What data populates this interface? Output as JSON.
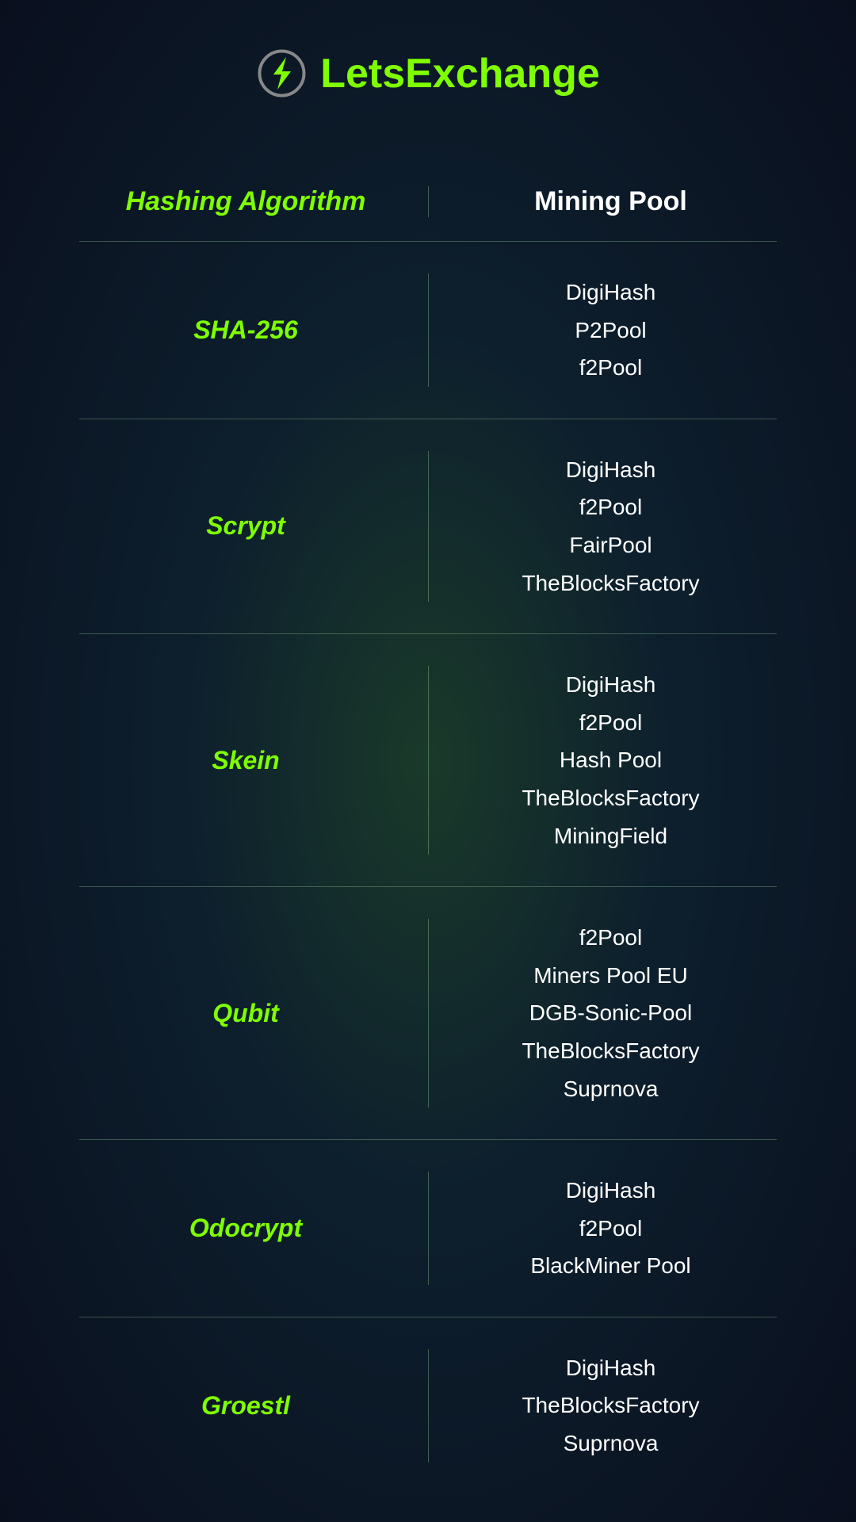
{
  "header": {
    "logo_text_plain": "Lets",
    "logo_text_accent": "Exchange",
    "logo_icon_label": "letsexchange-logo-icon"
  },
  "table": {
    "col1_header": "Hashing Algorithm",
    "col2_header": "Mining Pool",
    "rows": [
      {
        "algorithm": "SHA-256",
        "pools": [
          "DigiHash",
          "P2Pool",
          "f2Pool"
        ]
      },
      {
        "algorithm": "Scrypt",
        "pools": [
          "DigiHash",
          "f2Pool",
          "FairPool",
          "TheBlocksFactory"
        ]
      },
      {
        "algorithm": "Skein",
        "pools": [
          "DigiHash",
          "f2Pool",
          "Hash Pool",
          "TheBlocksFactory",
          "MiningField"
        ]
      },
      {
        "algorithm": "Qubit",
        "pools": [
          "f2Pool",
          "Miners Pool EU",
          "DGB-Sonic-Pool",
          "TheBlocksFactory",
          "Suprnova"
        ]
      },
      {
        "algorithm": "Odocrypt",
        "pools": [
          "DigiHash",
          "f2Pool",
          "BlackMiner Pool"
        ]
      },
      {
        "algorithm": "Groestl",
        "pools": [
          "DigiHash",
          "TheBlocksFactory",
          "Suprnova"
        ]
      }
    ]
  },
  "colors": {
    "accent_green": "#7fff00",
    "text_white": "#ffffff",
    "divider": "rgba(150,200,150,0.35)",
    "bg_gradient_center": "#1a3a2a",
    "bg_gradient_mid": "#0d1f2d",
    "bg_gradient_edge": "#0a0f1e"
  }
}
